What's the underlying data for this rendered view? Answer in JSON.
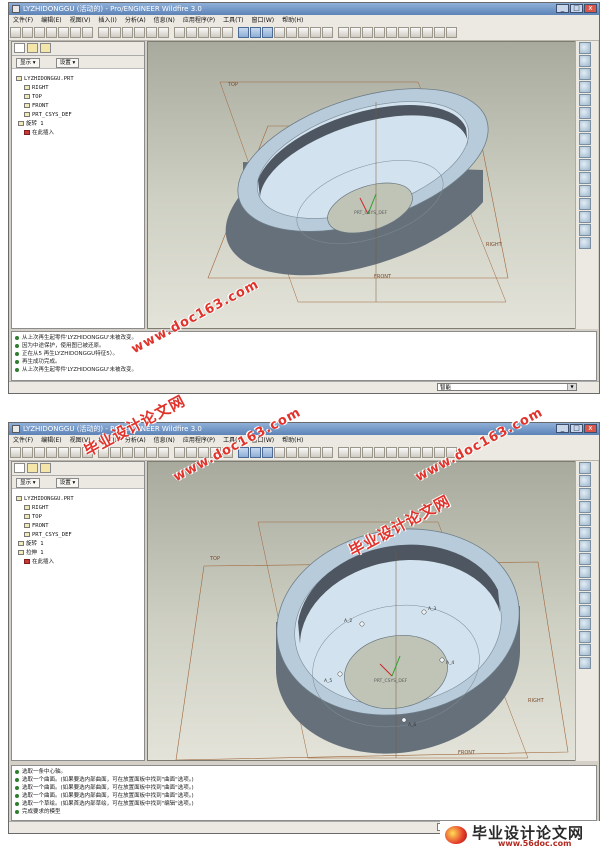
{
  "menu": [
    "文件(F)",
    "编辑(E)",
    "视图(V)",
    "插入(I)",
    "分析(A)",
    "信息(N)",
    "应用程序(P)",
    "工具(T)",
    "窗口(W)",
    "帮助(H)"
  ],
  "panel": {
    "show_label": "显示 ▾",
    "settings_label": "设置 ▾"
  },
  "icons": {
    "toolbar": "cad-toolbar-icon",
    "feature": "datum-feature-icon",
    "insert": "insert-here-icon"
  },
  "filter_label": "智能",
  "win1": {
    "title": "LYZHIDONGGU (活动的) - Pro/ENGINEER Wildfire 3.0",
    "tree": [
      {
        "label": "LYZHIDONGGU.PRT",
        "icon": "part-icon"
      },
      {
        "label": "RIGHT",
        "icon": "datum-plane-icon"
      },
      {
        "label": "TOP",
        "icon": "datum-plane-icon"
      },
      {
        "label": "FRONT",
        "icon": "datum-plane-icon"
      },
      {
        "label": "PRT_CSYS_DEF",
        "icon": "csys-icon"
      },
      {
        "label": "旋转 1",
        "icon": "revolve-icon"
      },
      {
        "label": "在此插入",
        "icon": "insert-here-icon"
      }
    ],
    "datums": {
      "top": "TOP",
      "right": "RIGHT",
      "front": "FRONT",
      "csys": "PRT_CSYS_DEF"
    },
    "messages": [
      "从上次再生起零件'LYZHIDONGGU'未被改变。",
      "因为中途保护，使用图已被还原。",
      "正在从5 再生LYZHIDONGGU特征5）。",
      "再生成功完成。",
      "从上次再生起零件'LYZHIDONGGU'未被改变。"
    ]
  },
  "win2": {
    "title": "LYZHIDONGGU (活动的) - Pro/ENGINEER Wildfire 3.0",
    "tree": [
      {
        "label": "LYZHIDONGGU.PRT",
        "icon": "part-icon"
      },
      {
        "label": "RIGHT",
        "icon": "datum-plane-icon"
      },
      {
        "label": "TOP",
        "icon": "datum-plane-icon"
      },
      {
        "label": "FRONT",
        "icon": "datum-plane-icon"
      },
      {
        "label": "PRT_CSYS_DEF",
        "icon": "csys-icon"
      },
      {
        "label": "旋转 1",
        "icon": "revolve-icon"
      },
      {
        "label": "拉伸 1",
        "icon": "extrude-icon"
      },
      {
        "label": "在此插入",
        "icon": "insert-here-icon"
      }
    ],
    "datums": {
      "top": "TOP",
      "right": "RIGHT",
      "front": "FRONT",
      "csys": "PRT_CSYS_DEF"
    },
    "hole_labels": [
      "A_2",
      "A_3",
      "A_4",
      "A_5",
      "A_6"
    ],
    "messages": [
      "选取一条中心轴。",
      "选取一个曲面。(如果要选内部曲面，可在放置面板中找到\"曲面\"选项。)",
      "选取一个曲面。(如果要选内部曲面，可在放置面板中找到\"曲面\"选项。)",
      "选取一个曲面。(如果要选内部曲面，可在放置面板中找到\"曲面\"选项。)",
      "选取一个草绘。(如果首选内部草绘，可在放置面板中找到\"编辑\"选项。)",
      "完成要求的模型"
    ]
  },
  "watermarks": {
    "url1": "www.doc163.com",
    "cn1": "毕业设计论文网",
    "url2": "www.doc163.com",
    "cn2": "毕业设计论文网",
    "url3": "www.doc163.com"
  },
  "footer_logo": {
    "title": "毕业设计论文网",
    "url": "www.56doc.com"
  }
}
